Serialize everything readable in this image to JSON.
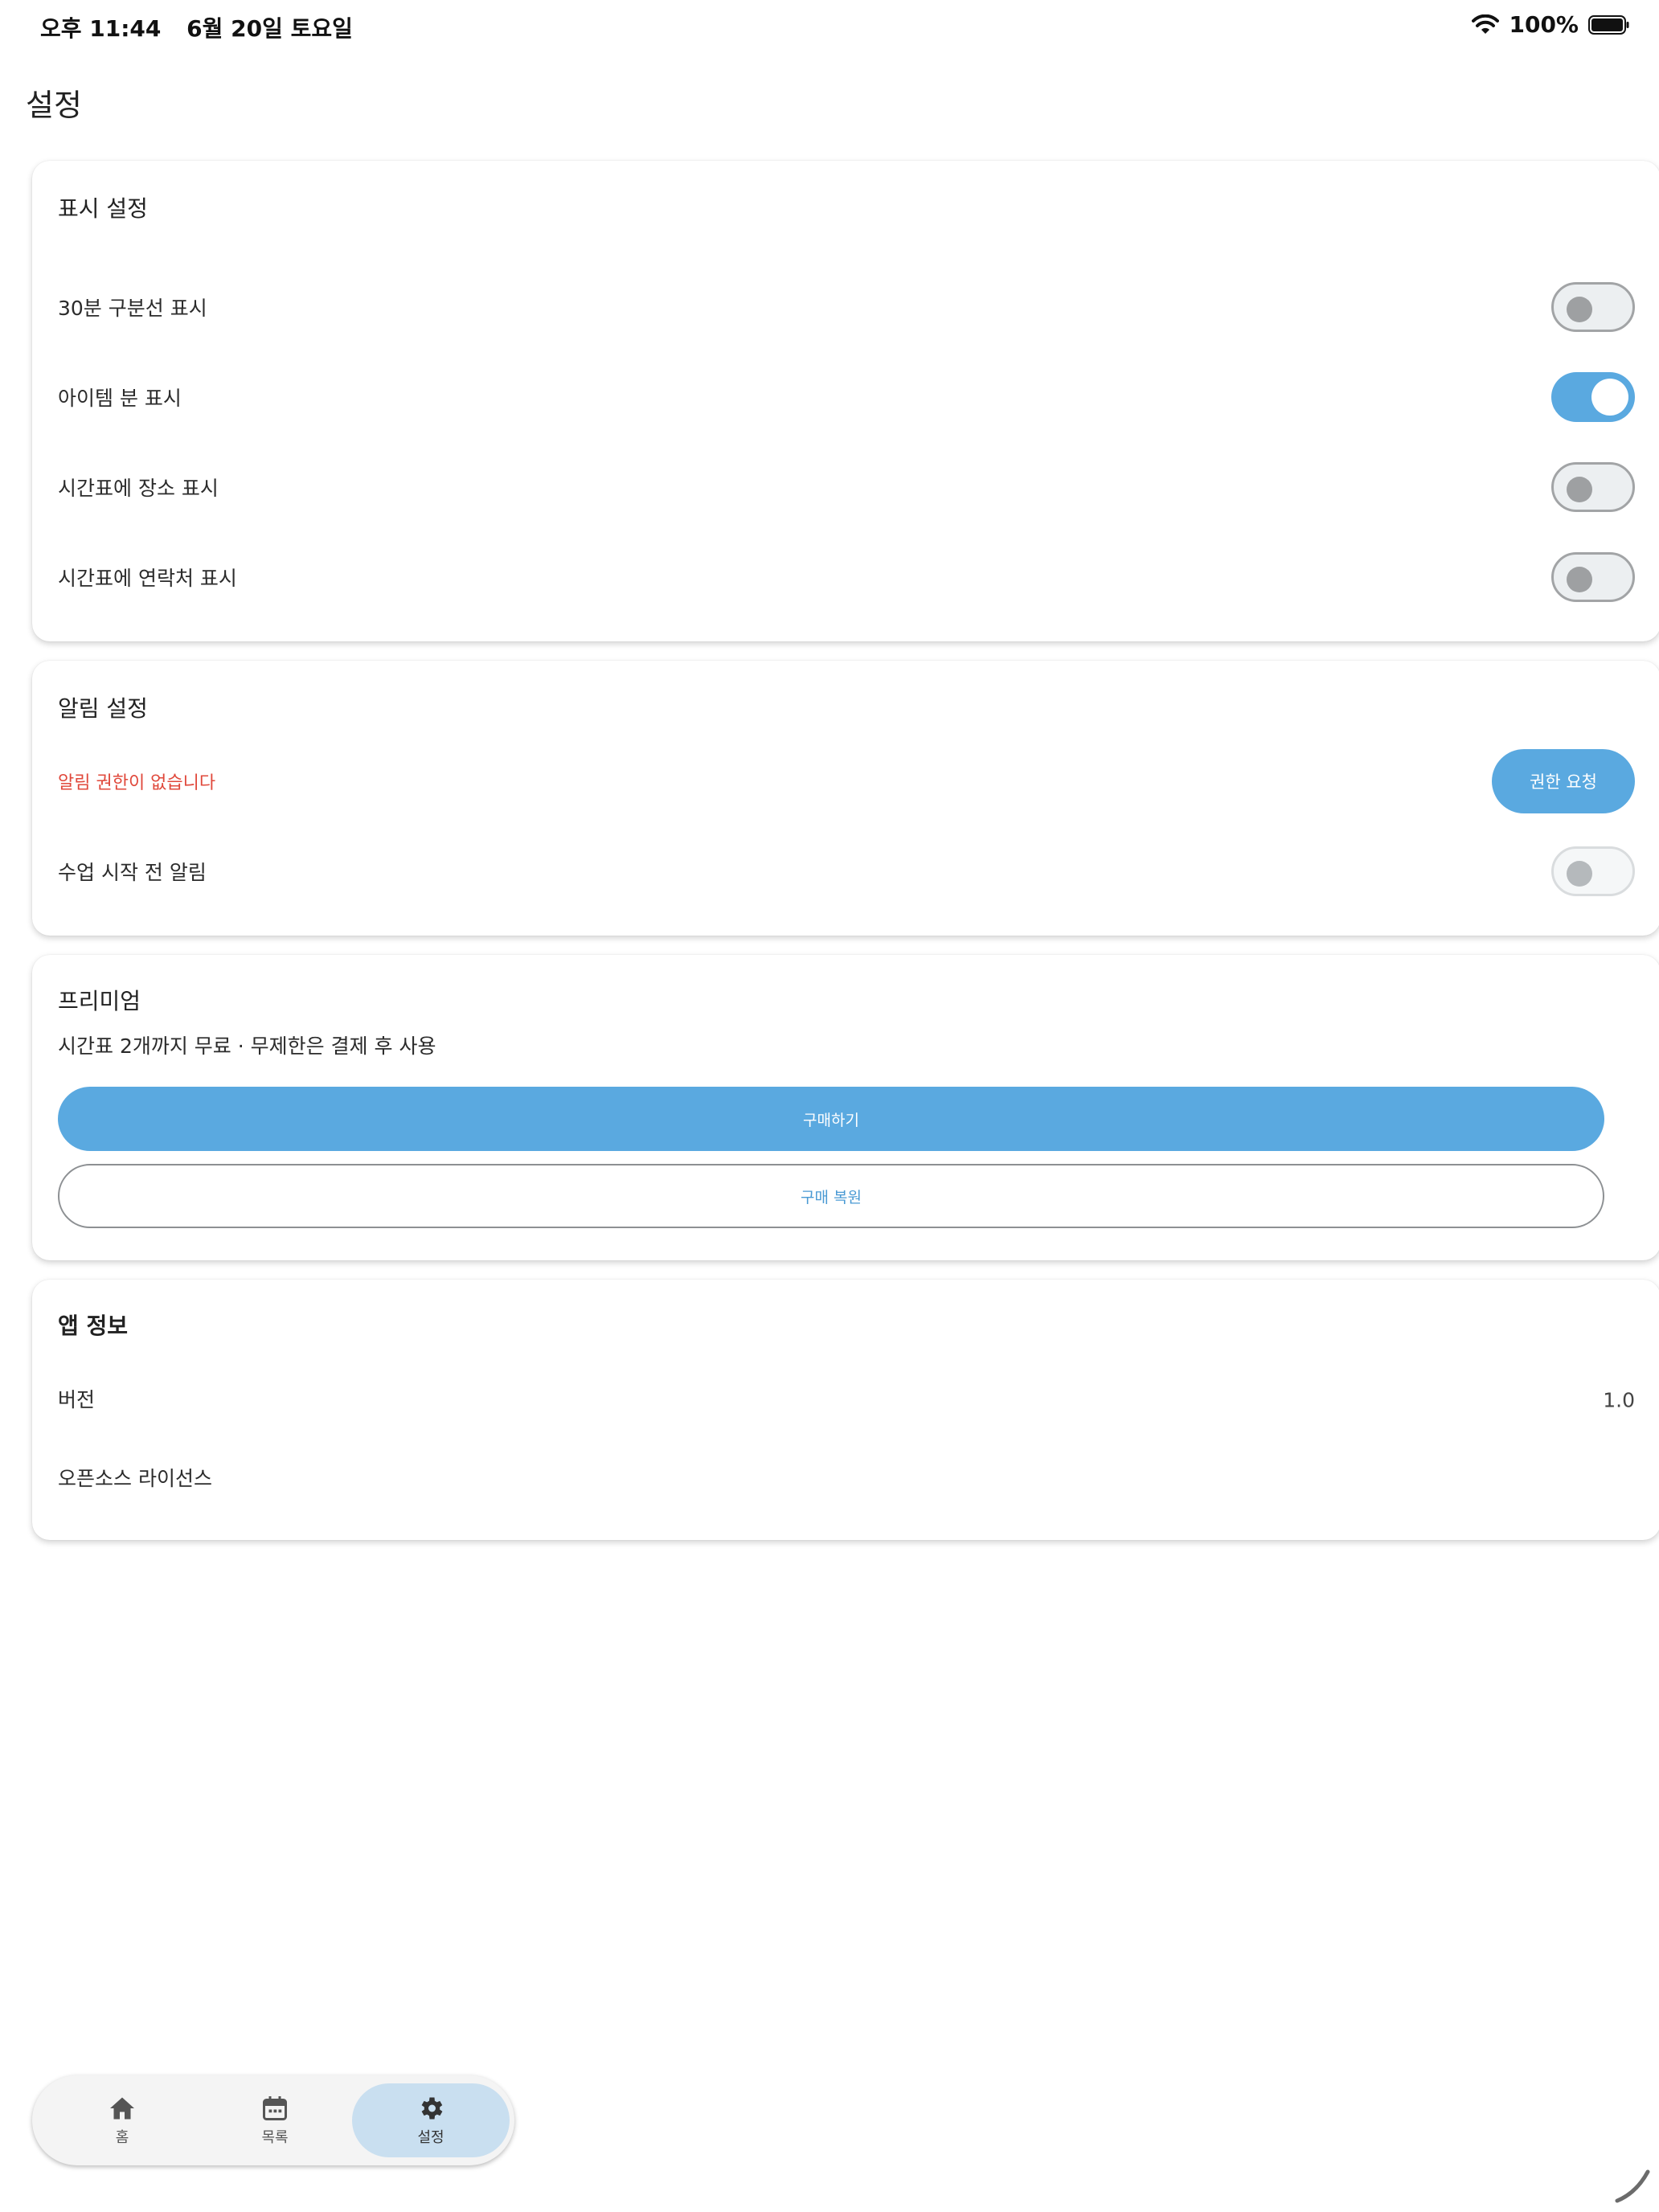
{
  "status_bar": {
    "time": "오후 11:44",
    "date": "6월 20일 토요일",
    "battery_percent": "100%",
    "battery_level": 1.0,
    "icons": [
      "wifi-icon",
      "battery-icon"
    ]
  },
  "page": {
    "title": "설정"
  },
  "display_settings": {
    "title": "표시 설정",
    "rows": [
      {
        "label": "30분 구분선 표시",
        "on": false
      },
      {
        "label": "아이템 분 표시",
        "on": true
      },
      {
        "label": "시간표에 장소 표시",
        "on": false
      },
      {
        "label": "시간표에 연락처 표시",
        "on": false
      }
    ]
  },
  "notification_settings": {
    "title": "알림 설정",
    "permission_warning": "알림 권한이 없습니다",
    "request_button": "권한 요청",
    "row": {
      "label": "수업 시작 전 알림",
      "on": false,
      "enabled": false
    }
  },
  "premium": {
    "title": "프리미엄",
    "description": "시간표 2개까지 무료 · 무제한은 결제 후 사용",
    "purchase_button": "구매하기",
    "restore_button": "구매 복원"
  },
  "app_info": {
    "title": "앱 정보",
    "version_label": "버전",
    "version_value": "1.0",
    "license_label": "오픈소스 라이선스"
  },
  "bottom_nav": {
    "items": [
      {
        "label": "홈",
        "icon": "home-icon",
        "active": false
      },
      {
        "label": "목록",
        "icon": "calendar-icon",
        "active": false
      },
      {
        "label": "설정",
        "icon": "gear-icon",
        "active": true
      }
    ]
  },
  "colors": {
    "accent": "#5aa9e0",
    "warning": "#e0483b",
    "nav_active_bg": "#c9dff0"
  }
}
